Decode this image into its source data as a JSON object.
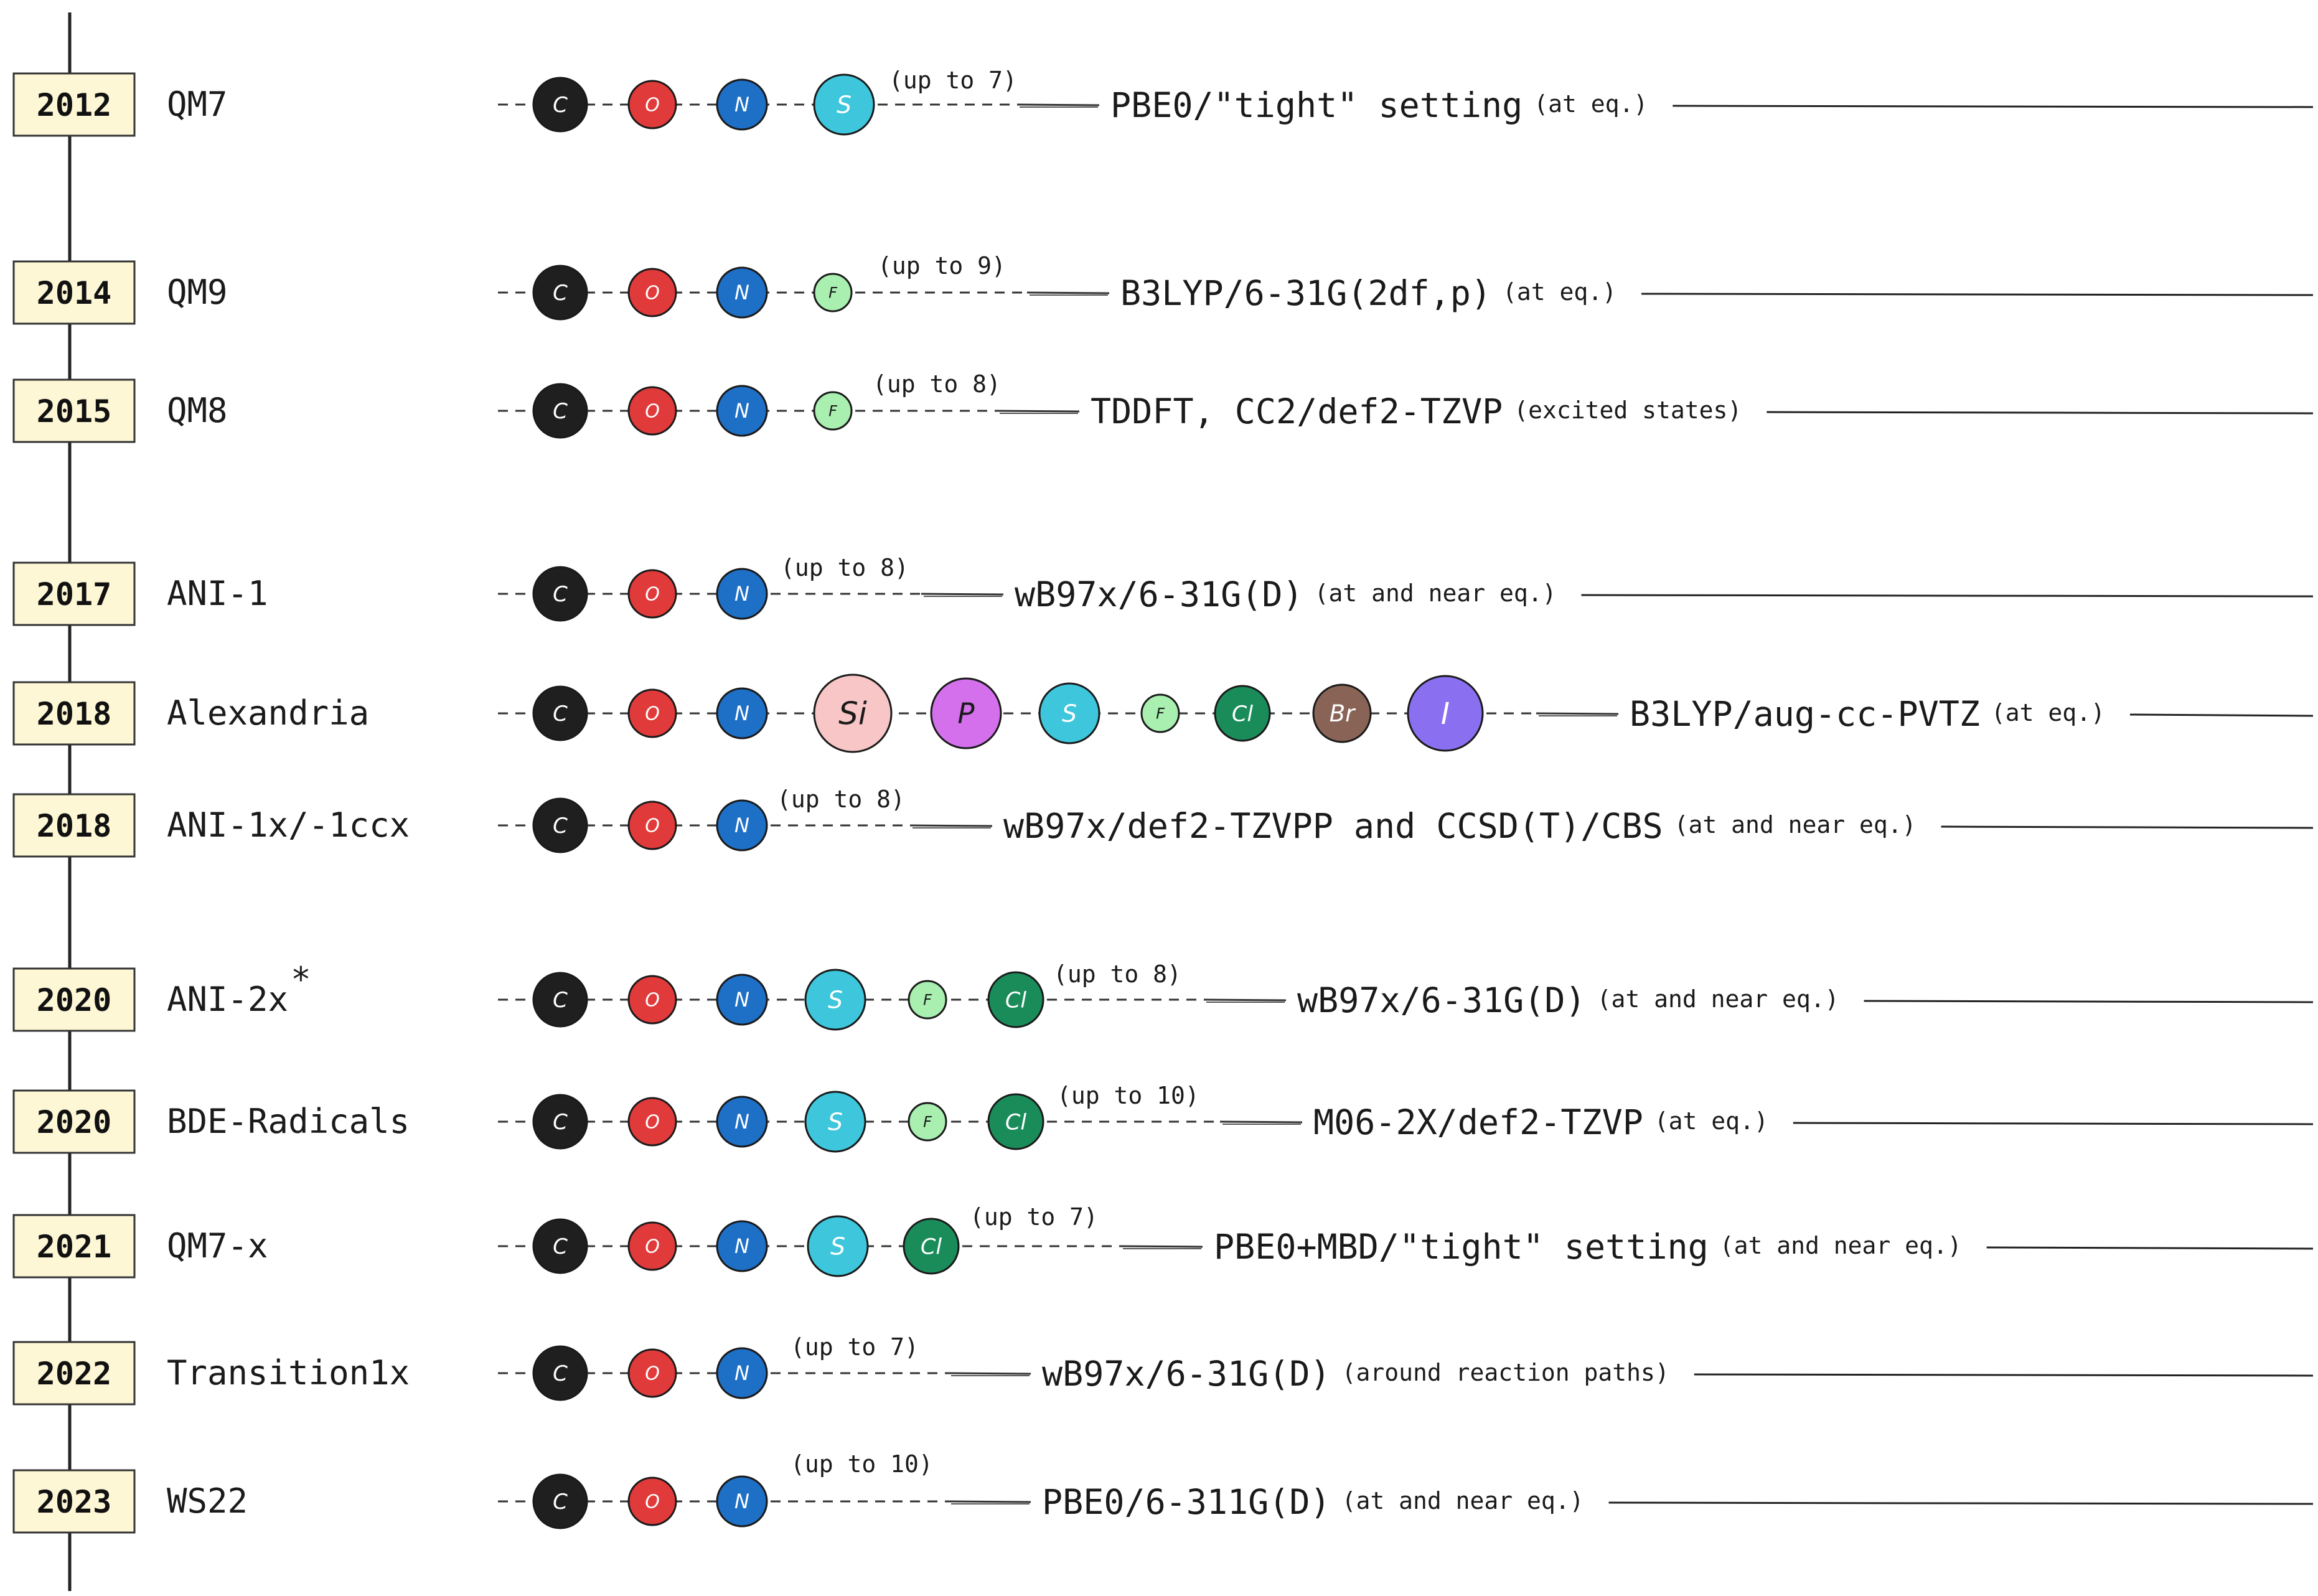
{
  "colors": {
    "axis": "#222222",
    "year_box_fill": "#fdf7d6",
    "year_box_stroke": "#333333",
    "C": "#1f1f1f",
    "O": "#e03a3a",
    "N": "#1e6fc6",
    "S": "#3dc6dc",
    "F": "#a8efb0",
    "Si": "#f8c6c6",
    "P": "#d470ec",
    "Cl": "#1a8c5a",
    "Br": "#8a6357",
    "I": "#8a6ff0"
  },
  "rows": [
    {
      "year": "2012",
      "name": "QM7",
      "sup": "",
      "upto": "(up to 7)",
      "method": "PBE0/\"tight\" setting",
      "condition": "(at eq.)",
      "elements": [
        {
          "symbol": "C"
        },
        {
          "symbol": "O"
        },
        {
          "symbol": "N"
        },
        {
          "symbol": "S"
        }
      ]
    },
    {
      "year": "2014",
      "name": "QM9",
      "sup": "",
      "upto": "(up to 9)",
      "method": "B3LYP/6-31G(2df,p)",
      "condition": "(at eq.)",
      "elements": [
        {
          "symbol": "C"
        },
        {
          "symbol": "O"
        },
        {
          "symbol": "N"
        },
        {
          "symbol": "F"
        }
      ]
    },
    {
      "year": "2015",
      "name": "QM8",
      "sup": "",
      "upto": "(up to 8)",
      "method": "TDDFT, CC2/def2-TZVP",
      "condition": "(excited states)",
      "elements": [
        {
          "symbol": "C"
        },
        {
          "symbol": "O"
        },
        {
          "symbol": "N"
        },
        {
          "symbol": "F"
        }
      ]
    },
    {
      "year": "2017",
      "name": "ANI-1",
      "sup": "",
      "upto": "(up to 8)",
      "method": "wB97x/6-31G(D)",
      "condition": "(at and near eq.)",
      "elements": [
        {
          "symbol": "C"
        },
        {
          "symbol": "O"
        },
        {
          "symbol": "N"
        }
      ]
    },
    {
      "year": "2018",
      "name": "Alexandria",
      "sup": "",
      "upto": "",
      "method": "B3LYP/aug-cc-PVTZ",
      "condition": "(at eq.)",
      "elements": [
        {
          "symbol": "C"
        },
        {
          "symbol": "O"
        },
        {
          "symbol": "N"
        },
        {
          "symbol": "Si"
        },
        {
          "symbol": "P"
        },
        {
          "symbol": "S"
        },
        {
          "symbol": "F"
        },
        {
          "symbol": "Cl"
        },
        {
          "symbol": "Br"
        },
        {
          "symbol": "I"
        }
      ]
    },
    {
      "year": "2018",
      "name": "ANI-1x/-1ccx",
      "sup": "",
      "upto": "(up to 8)",
      "method": "wB97x/def2-TZVPP and CCSD(T)/CBS",
      "condition": "(at and near eq.)",
      "elements": [
        {
          "symbol": "C"
        },
        {
          "symbol": "O"
        },
        {
          "symbol": "N"
        }
      ]
    },
    {
      "year": "2020",
      "name": "ANI-2x",
      "sup": "*",
      "upto": "(up to 8)",
      "method": "wB97x/6-31G(D)",
      "condition": "(at and near eq.)",
      "elements": [
        {
          "symbol": "C"
        },
        {
          "symbol": "O"
        },
        {
          "symbol": "N"
        },
        {
          "symbol": "S"
        },
        {
          "symbol": "F"
        },
        {
          "symbol": "Cl"
        }
      ]
    },
    {
      "year": "2020",
      "name": "BDE-Radicals",
      "sup": "",
      "upto": "(up to 10)",
      "method": "M06-2X/def2-TZVP",
      "condition": "(at eq.)",
      "elements": [
        {
          "symbol": "C"
        },
        {
          "symbol": "O"
        },
        {
          "symbol": "N"
        },
        {
          "symbol": "S"
        },
        {
          "symbol": "F"
        },
        {
          "symbol": "Cl"
        }
      ]
    },
    {
      "year": "2021",
      "name": "QM7-x",
      "sup": "",
      "upto": "(up to 7)",
      "method": "PBE0+MBD/\"tight\" setting",
      "condition": "(at and near eq.)",
      "elements": [
        {
          "symbol": "C"
        },
        {
          "symbol": "O"
        },
        {
          "symbol": "N"
        },
        {
          "symbol": "S"
        },
        {
          "symbol": "Cl"
        }
      ]
    },
    {
      "year": "2022",
      "name": "Transition1x",
      "sup": "",
      "upto": "(up to 7)",
      "method": "wB97x/6-31G(D)",
      "condition": "(around reaction paths)",
      "elements": [
        {
          "symbol": "C"
        },
        {
          "symbol": "O"
        },
        {
          "symbol": "N"
        }
      ]
    },
    {
      "year": "2023",
      "name": "WS22",
      "sup": "",
      "upto": "(up to 10)",
      "method": "PBE0/6-311G(D)",
      "condition": "(at and near eq.)",
      "elements": [
        {
          "symbol": "C"
        },
        {
          "symbol": "O"
        },
        {
          "symbol": "N"
        }
      ]
    }
  ]
}
